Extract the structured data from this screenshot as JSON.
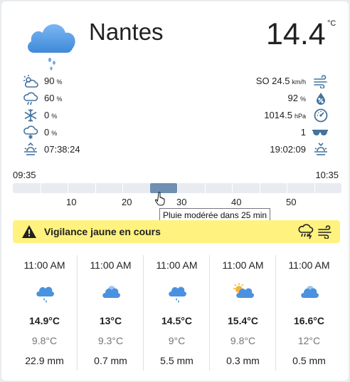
{
  "header": {
    "city": "Nantes",
    "temperature": "14.4",
    "temperature_unit": "°C",
    "condition_icon": "cloud-rain-icon"
  },
  "left_stats": [
    {
      "icon": "sun-cloudy-icon",
      "value": "90",
      "unit": "%"
    },
    {
      "icon": "cloud-rain-icon",
      "value": "60",
      "unit": "%"
    },
    {
      "icon": "snowflake-icon",
      "value": "0",
      "unit": "%"
    },
    {
      "icon": "cloud-snow-icon",
      "value": "0",
      "unit": "%"
    },
    {
      "icon": "sunrise-icon",
      "value": "07:38:24",
      "unit": ""
    }
  ],
  "right_stats": [
    {
      "icon": "wind-icon",
      "value": "SO 24.5",
      "unit": "km/h"
    },
    {
      "icon": "humidity-drop-icon",
      "value": "92",
      "unit": "%"
    },
    {
      "icon": "gauge-icon",
      "value": "1014.5",
      "unit": "hPa"
    },
    {
      "icon": "sunglasses-icon",
      "value": "1",
      "unit": ""
    },
    {
      "icon": "sunset-icon",
      "value": "19:02:09",
      "unit": ""
    }
  ],
  "rain_timeline": {
    "start": "09:35",
    "end": "10:35",
    "ticks": [
      "10",
      "20",
      "30",
      "40",
      "50"
    ],
    "rain_start_min": 25,
    "rain_end_min": 30,
    "tooltip": "Pluie modérée dans 25 min"
  },
  "alert": {
    "text": "Vigilance jaune en cours",
    "color": "#fff27f",
    "icons": [
      "warning-icon",
      "storm-rain-icon",
      "wind-icon"
    ]
  },
  "forecast": [
    {
      "time": "11:00 AM",
      "icon": "cloud-rain-icon",
      "high": "14.9°C",
      "low": "9.8°C",
      "precip": "22.9 mm"
    },
    {
      "time": "11:00 AM",
      "icon": "cloud-sun-icon",
      "high": "13°C",
      "low": "9.3°C",
      "precip": "0.7 mm"
    },
    {
      "time": "11:00 AM",
      "icon": "cloud-rain-icon",
      "high": "14.5°C",
      "low": "9°C",
      "precip": "5.5 mm"
    },
    {
      "time": "11:00 AM",
      "icon": "sun-behind-cloud-icon",
      "high": "15.4°C",
      "low": "9.8°C",
      "precip": "0.3 mm"
    },
    {
      "time": "11:00 AM",
      "icon": "cloud-sun-icon",
      "high": "16.6°C",
      "low": "12°C",
      "precip": "0.5 mm"
    }
  ],
  "colors": {
    "cloud": "#5a9ee6",
    "icon_stroke": "#44739e",
    "bar": "#e8ecf0",
    "bar_fill": "#6f90b2",
    "sun": "#f4b63b"
  }
}
